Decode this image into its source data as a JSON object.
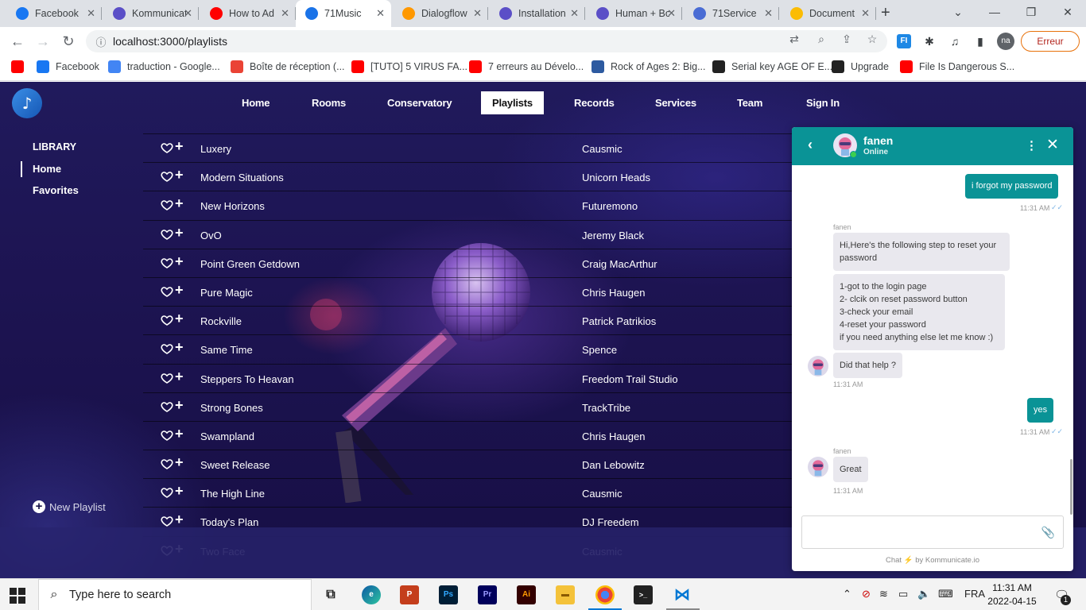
{
  "browser": {
    "tabs": [
      {
        "title": "Facebook",
        "icon": "facebook-icon",
        "color": "#1877f2"
      },
      {
        "title": "Kommunicate",
        "icon": "kommunicate-icon",
        "color": "#5b4fc7"
      },
      {
        "title": "How to Ad",
        "icon": "youtube-icon",
        "color": "#ff0000"
      },
      {
        "title": "71Music",
        "icon": "71music-icon",
        "color": "#1a73e8",
        "active": true
      },
      {
        "title": "Dialogflow",
        "icon": "dialogflow-icon",
        "color": "#ff9800"
      },
      {
        "title": "Installation",
        "icon": "kommunicate-icon",
        "color": "#5b4fc7"
      },
      {
        "title": "Human + Bot",
        "icon": "kommunicate-icon",
        "color": "#5b4fc7"
      },
      {
        "title": "71Service",
        "icon": "shield-icon",
        "color": "#4a6cd4"
      },
      {
        "title": "Document",
        "icon": "google-drive-icon",
        "color": "#fbbc04"
      }
    ],
    "url": "localhost:3000/playlists",
    "profile_initials": "na",
    "error_button": "Erreur",
    "bookmarks": [
      {
        "label": "",
        "icon": "youtube-icon",
        "color": "#ff0000"
      },
      {
        "label": "Facebook",
        "icon": "facebook-icon",
        "color": "#1877f2"
      },
      {
        "label": "traduction - Google...",
        "icon": "google-icon",
        "color": "#4285f4"
      },
      {
        "label": "Boîte de réception (...",
        "icon": "gmail-icon",
        "color": "#ea4335"
      },
      {
        "label": "[TUTO] 5 VIRUS FA...",
        "icon": "youtube-icon",
        "color": "#ff0000"
      },
      {
        "label": "7 erreurs au Dévelo...",
        "icon": "youtube-icon",
        "color": "#ff0000"
      },
      {
        "label": "Rock of Ages 2: Big...",
        "icon": "download-icon",
        "color": "#2d5aa0"
      },
      {
        "label": "Serial key AGE OF E...",
        "icon": "font-icon",
        "color": "#222222"
      },
      {
        "label": "Upgrade",
        "icon": "user-icon",
        "color": "#222222"
      },
      {
        "label": "File Is Dangerous S...",
        "icon": "youtube-icon",
        "color": "#ff0000"
      }
    ]
  },
  "site": {
    "nav": [
      "Home",
      "Rooms",
      "Conservatory",
      "Playlists",
      "Records",
      "Services",
      "Team",
      "Sign In"
    ],
    "active_nav": "Playlists",
    "library_title": "LIBRARY",
    "library_items": [
      "Home",
      "Favorites"
    ],
    "new_playlist": "New Playlist",
    "songs": [
      {
        "title": "Luxery",
        "artist": "Causmic"
      },
      {
        "title": "Modern Situations",
        "artist": "Unicorn Heads"
      },
      {
        "title": "New Horizons",
        "artist": "Futuremono"
      },
      {
        "title": "OvO",
        "artist": "Jeremy Black"
      },
      {
        "title": "Point Green Getdown",
        "artist": "Craig MacArthur"
      },
      {
        "title": "Pure Magic",
        "artist": "Chris Haugen"
      },
      {
        "title": "Rockville",
        "artist": "Patrick Patrikios"
      },
      {
        "title": "Same Time",
        "artist": "Spence"
      },
      {
        "title": "Steppers To Heavan",
        "artist": "Freedom Trail Studio"
      },
      {
        "title": "Strong Bones",
        "artist": "TrackTribe"
      },
      {
        "title": "Swampland",
        "artist": "Chris Haugen"
      },
      {
        "title": "Sweet Release",
        "artist": "Dan Lebowitz"
      },
      {
        "title": "The High Line",
        "artist": "Causmic"
      },
      {
        "title": "Today's Plan",
        "artist": "DJ Freedem"
      },
      {
        "title": "Two Face",
        "artist": "Causmic"
      }
    ]
  },
  "chat": {
    "agent_name": "fanen",
    "status": "Online",
    "msg1": "i forgot my password",
    "time1": "11:31 AM",
    "sender1": "fanen",
    "msg2": "Hi,Here's the following step to reset your password",
    "msg3": "1-got to the login page\n2- clcik on reset password button\n3-check your email\n4-reset your password\nif you need anything else let me know  :)",
    "msg4": "Did that help ?",
    "time2": "11:31 AM",
    "msg5": "yes",
    "time3": "11:31 AM",
    "sender2": "fanen",
    "msg6": "Great",
    "time4": "11:31 AM",
    "powered_prefix": "Chat",
    "powered_suffix": "by Kommunicate.io"
  },
  "taskbar": {
    "search_placeholder": "Type here to search",
    "language": "FRA",
    "time": "11:31 AM",
    "date": "2022-04-15",
    "notification_count": "1"
  }
}
